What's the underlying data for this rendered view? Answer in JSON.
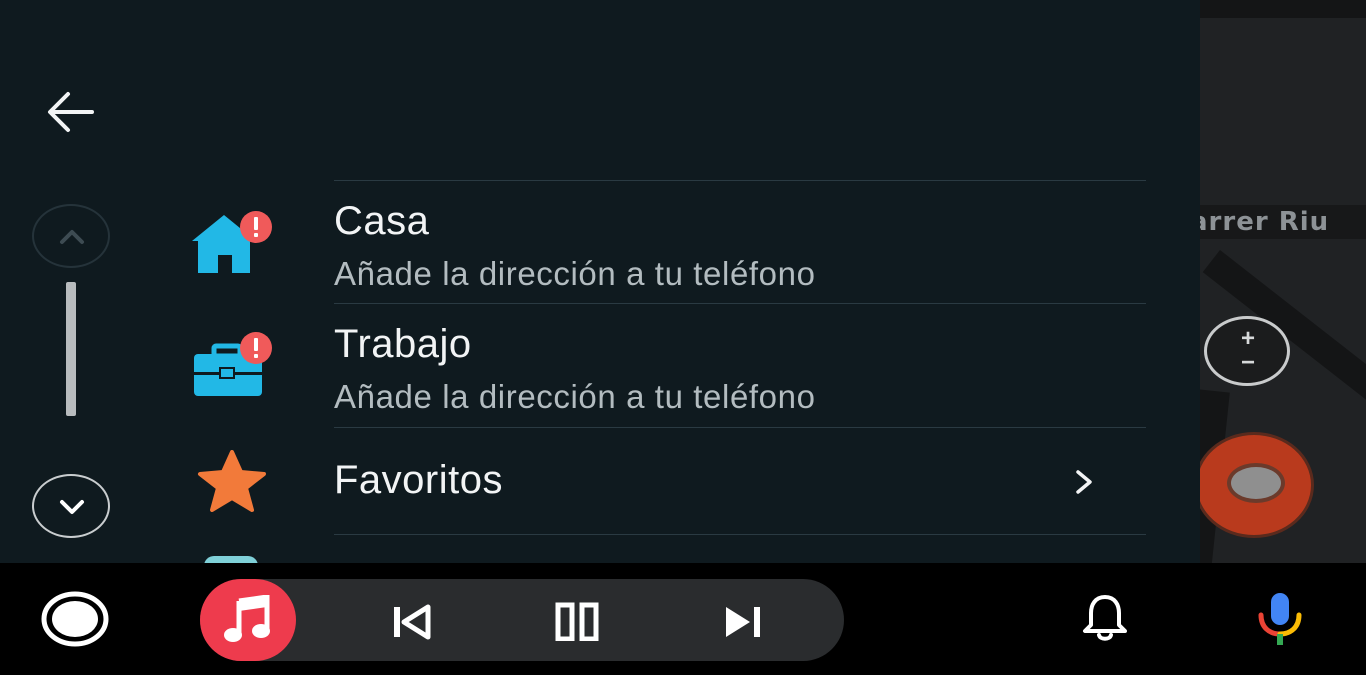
{
  "map": {
    "street_label": "arrer Riu",
    "zoom_plus": "+",
    "zoom_minus": "−"
  },
  "menu": {
    "items": [
      {
        "title": "Casa",
        "subtitle": "Añade la dirección a tu teléfono",
        "icon": "home-icon",
        "badge": "!"
      },
      {
        "title": "Trabajo",
        "subtitle": "Añade la dirección a tu teléfono",
        "icon": "briefcase-icon",
        "badge": "!"
      },
      {
        "title": "Favoritos",
        "icon": "star-icon"
      }
    ]
  },
  "colors": {
    "panel_bg": "#0f1a1f",
    "home_icon": "#22b8e6",
    "badge": "#f05a5a",
    "star": "#f27a3a",
    "music_button": "#ee3b4d",
    "report_button": "#b93a1d"
  },
  "icons": {
    "back": "arrow-left-icon",
    "scroll_up": "chevron-up-icon",
    "scroll_down": "chevron-down-icon",
    "home_button": "circle-home-icon",
    "music": "music-note-icon",
    "previous": "skip-previous-icon",
    "pause": "pause-icon",
    "next": "skip-next-icon",
    "notifications": "bell-icon",
    "voice": "mic-icon",
    "chevron": "chevron-right-icon"
  }
}
